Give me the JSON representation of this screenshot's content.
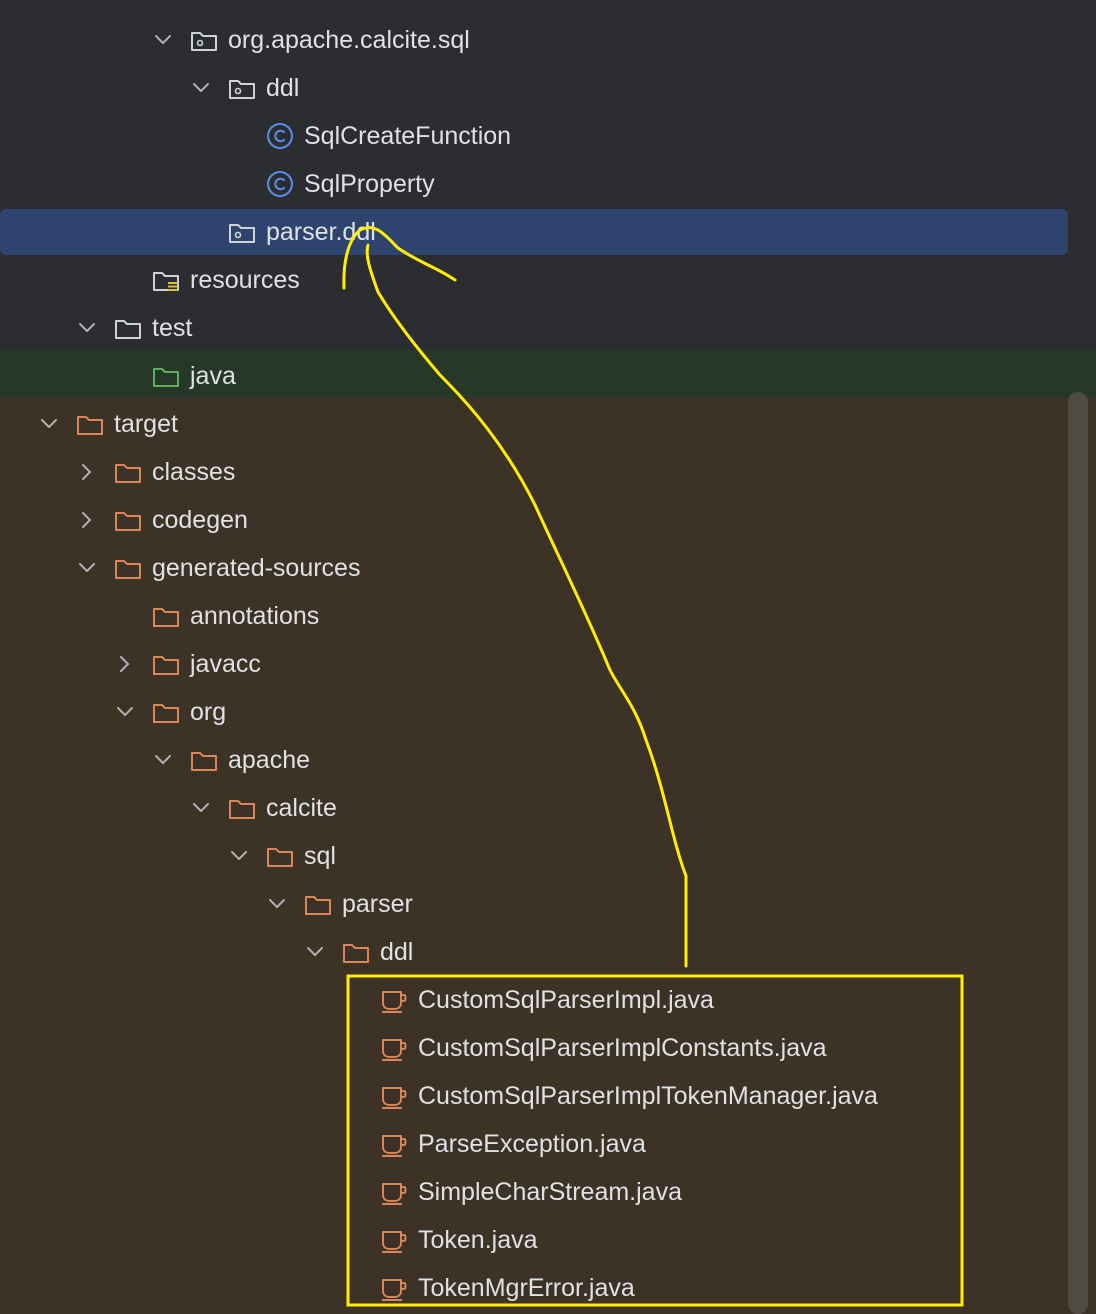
{
  "tree": [
    {
      "label": "org.apache.calcite.sql",
      "depth": 4,
      "expanded": true,
      "icon": "package",
      "name": "tree-item-org-apache-calcite-sql"
    },
    {
      "label": "ddl",
      "depth": 5,
      "expanded": true,
      "icon": "package",
      "name": "tree-item-ddl"
    },
    {
      "label": "SqlCreateFunction",
      "depth": 6,
      "icon": "class",
      "name": "tree-item-sqlcreatefunction"
    },
    {
      "label": "SqlProperty",
      "depth": 6,
      "icon": "class",
      "name": "tree-item-sqlproperty"
    },
    {
      "label": "parser.ddl",
      "depth": 5,
      "icon": "package",
      "selected": true,
      "name": "tree-item-parser-ddl"
    },
    {
      "label": "resources",
      "depth": 3,
      "icon": "resources-folder",
      "name": "tree-item-resources"
    },
    {
      "label": "test",
      "depth": 2,
      "expanded": true,
      "icon": "folder",
      "name": "tree-item-test"
    },
    {
      "label": "java",
      "depth": 3,
      "icon": "test-source-folder",
      "name": "tree-item-java"
    },
    {
      "label": "target",
      "depth": 1,
      "expanded": true,
      "icon": "excluded-folder",
      "name": "tree-item-target"
    },
    {
      "label": "classes",
      "depth": 2,
      "expanded": false,
      "icon": "excluded-folder",
      "name": "tree-item-classes"
    },
    {
      "label": "codegen",
      "depth": 2,
      "expanded": false,
      "icon": "excluded-folder",
      "name": "tree-item-codegen"
    },
    {
      "label": "generated-sources",
      "depth": 2,
      "expanded": true,
      "icon": "excluded-folder",
      "name": "tree-item-generated-sources"
    },
    {
      "label": "annotations",
      "depth": 3,
      "icon": "excluded-folder",
      "name": "tree-item-annotations"
    },
    {
      "label": "javacc",
      "depth": 3,
      "expanded": false,
      "icon": "excluded-folder",
      "name": "tree-item-javacc"
    },
    {
      "label": "org",
      "depth": 3,
      "expanded": true,
      "icon": "excluded-folder",
      "name": "tree-item-org"
    },
    {
      "label": "apache",
      "depth": 4,
      "expanded": true,
      "icon": "excluded-folder",
      "name": "tree-item-apache"
    },
    {
      "label": "calcite",
      "depth": 5,
      "expanded": true,
      "icon": "excluded-folder",
      "name": "tree-item-calcite"
    },
    {
      "label": "sql",
      "depth": 6,
      "expanded": true,
      "icon": "excluded-folder",
      "name": "tree-item-sql"
    },
    {
      "label": "parser",
      "depth": 7,
      "expanded": true,
      "icon": "excluded-folder",
      "name": "tree-item-parser"
    },
    {
      "label": "ddl",
      "depth": 8,
      "expanded": true,
      "icon": "excluded-folder",
      "name": "tree-item-generated-ddl"
    },
    {
      "label": "CustomSqlParserImpl.java",
      "depth": 9,
      "icon": "java-file",
      "name": "tree-item-customsqlparserimpl-java"
    },
    {
      "label": "CustomSqlParserImplConstants.java",
      "depth": 9,
      "icon": "java-file",
      "name": "tree-item-customsqlparserimplconstants-java"
    },
    {
      "label": "CustomSqlParserImplTokenManager.java",
      "depth": 9,
      "icon": "java-file",
      "name": "tree-item-customsqlparserimpltokenmanager-java"
    },
    {
      "label": "ParseException.java",
      "depth": 9,
      "icon": "java-file",
      "name": "tree-item-parseexception-java"
    },
    {
      "label": "SimpleCharStream.java",
      "depth": 9,
      "icon": "java-file",
      "name": "tree-item-simplecharstream-java"
    },
    {
      "label": "Token.java",
      "depth": 9,
      "icon": "java-file",
      "name": "tree-item-token-java"
    },
    {
      "label": "TokenMgrError.java",
      "depth": 9,
      "icon": "java-file",
      "name": "tree-item-tokenmgrerror-java"
    }
  ],
  "colors": {
    "selection": "#2e436e",
    "test_row": "#273828",
    "excluded_bg": "#3d3226",
    "excluded_folder": "#d8865a",
    "class_icon": "#5b8de8",
    "test_folder": "#5fae63",
    "annotation": "#ffee00"
  }
}
